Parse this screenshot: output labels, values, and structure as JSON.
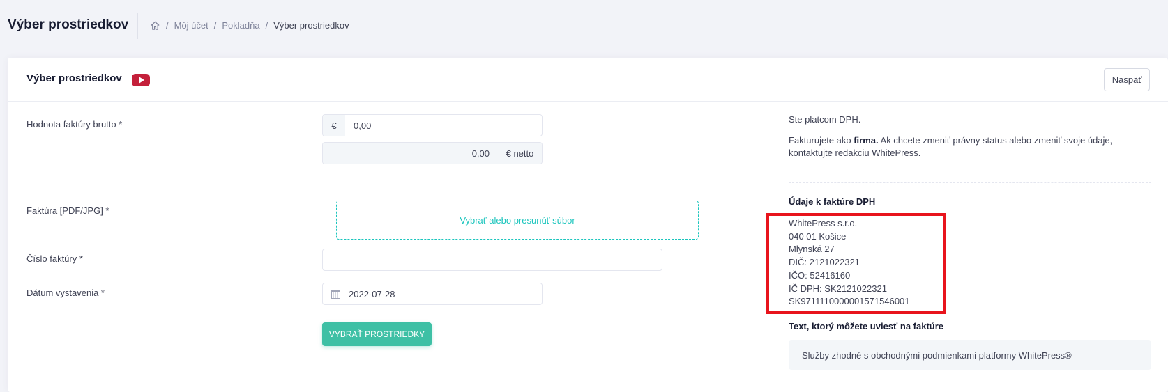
{
  "header": {
    "page_title": "Výber prostriedkov",
    "breadcrumb": [
      "Môj účet",
      "Pokladňa",
      "Výber prostriedkov"
    ]
  },
  "card": {
    "title": "Výber prostriedkov",
    "back_label": "Naspäť"
  },
  "form": {
    "gross_label": "Hodnota faktúry brutto  *",
    "currency_symbol": "€",
    "gross_value": "0,00",
    "net_value": "0,00",
    "net_addon": "€ netto",
    "invoice_file_label": "Faktúra [PDF/JPG] *",
    "dropzone_text": "Vybrať alebo presunúť súbor",
    "invoice_number_label": "Číslo faktúry *",
    "invoice_number_value": "",
    "issue_date_label": "Dátum vystavenia *",
    "issue_date_value": "2022-07-28",
    "submit_label": "VYBRAŤ PROSTRIEDKY"
  },
  "info": {
    "vat_payer": "Ste platcom DPH.",
    "status_prefix": "Fakturujete ako ",
    "status_bold": "firma.",
    "status_line1_rest": " Ak chcete zmeniť právny status alebo zmeniť svoje údaje,",
    "status_line2": "kontaktujte redakciu WhitePress.",
    "invoice_data_heading": "Údaje k faktúre DPH",
    "company_lines": [
      "WhitePress s.r.o.",
      "040 01 Košice",
      "Mlynská 27",
      "DIČ: 2121022321",
      "IČO: 52416160",
      "IČ DPH: SK2121022321",
      "SK9711110000001571546001"
    ],
    "invoice_text_heading": "Text, ktorý môžete uviesť na faktúre",
    "invoice_text": "Služby zhodné s obchodnými podmienkami platformy WhitePress®"
  },
  "colors": {
    "accent": "#3ec0a5",
    "dropzone": "#1bc5bd",
    "highlight": "#e8141c",
    "youtube": "#c4203a"
  }
}
